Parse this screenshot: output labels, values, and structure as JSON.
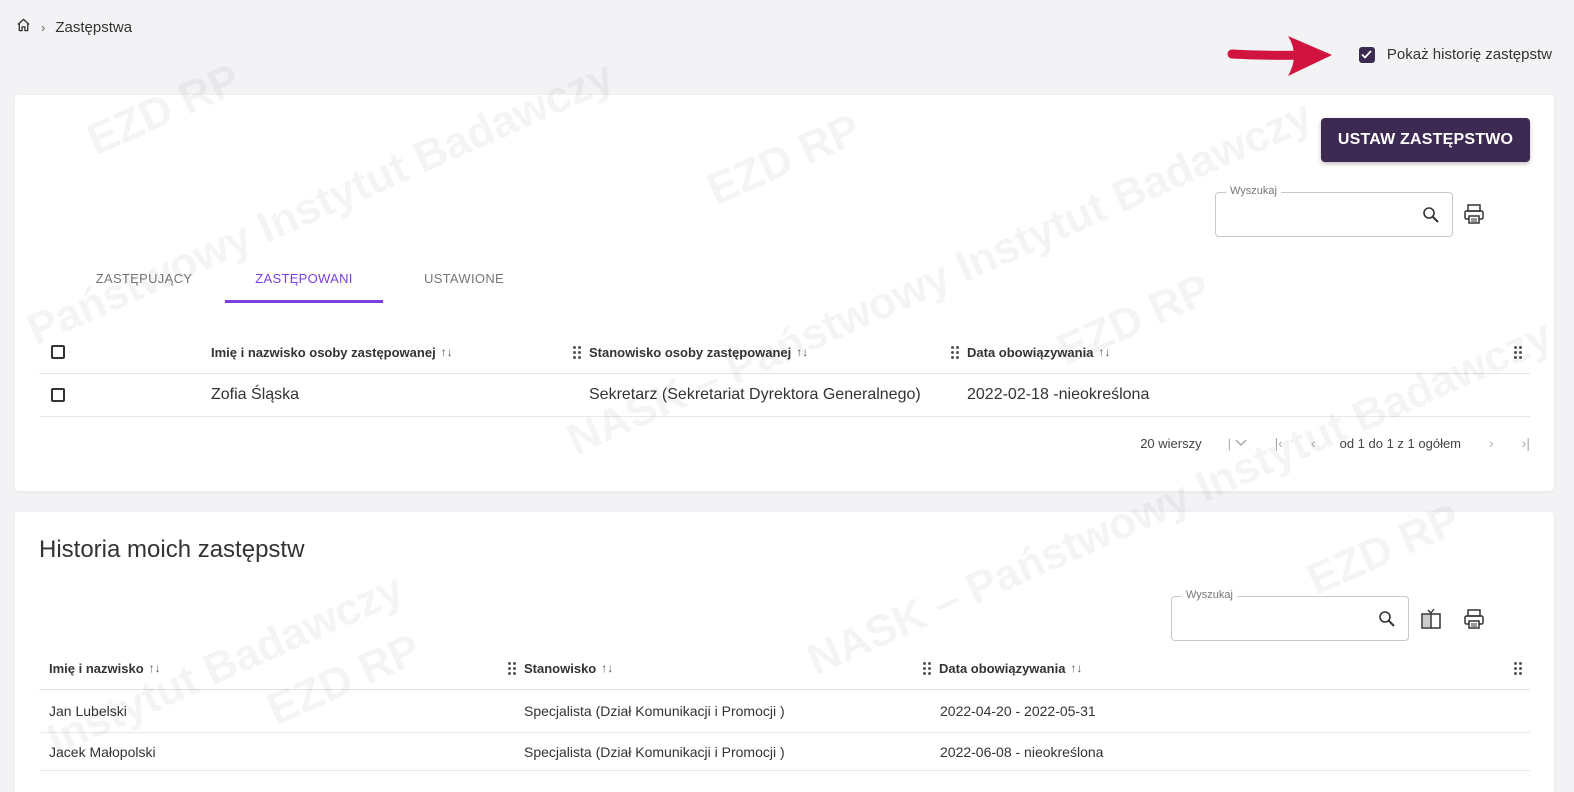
{
  "breadcrumb": {
    "home_icon": "home-icon",
    "current": "Zastępstwa"
  },
  "history_toggle": {
    "label": "Pokaż historię zastępstw",
    "checked": true
  },
  "annotation": {
    "arrow_color": "#d1143f"
  },
  "colors": {
    "primary": "#3d2a52",
    "tab_active": "#7a3fe0"
  },
  "top_card": {
    "set_button": "USTAW ZASTĘPSTWO",
    "search": {
      "label": "Wyszukaj",
      "value": ""
    },
    "tabs": [
      {
        "label": "ZASTĘPUJĄCY",
        "active": false
      },
      {
        "label": "ZASTĘPOWANI",
        "active": true
      },
      {
        "label": "USTAWIONE",
        "active": false
      }
    ],
    "table": {
      "columns": [
        "Imię i nazwisko osoby zastępowanej",
        "Stanowisko osoby zastępowanej",
        "Data obowiązywania"
      ],
      "rows": [
        {
          "name": "Zofia Śląska",
          "position": "Sekretarz (Sekretariat Dyrektora Generalnego)",
          "date": "2022-02-18 -nieokreślona"
        }
      ]
    },
    "pager": {
      "rows_per_page": "20 wierszy",
      "info": "od 1 do 1 z 1 ogółem"
    }
  },
  "history_card": {
    "title": "Historia moich zastępstw",
    "search": {
      "label": "Wyszukaj",
      "value": ""
    },
    "table": {
      "columns": [
        "Imię i nazwisko",
        "Stanowisko",
        "Data obowiązywania"
      ],
      "rows": [
        {
          "name": "Jan Lubelski",
          "position": "Specjalista (Dział Komunikacji i Promocji )",
          "date": "2022-04-20 - 2022-05-31"
        },
        {
          "name": "Jacek Małopolski",
          "position": "Specjalista (Dział Komunikacji i Promocji )",
          "date": "2022-06-08 - nieokreślona"
        }
      ]
    }
  }
}
